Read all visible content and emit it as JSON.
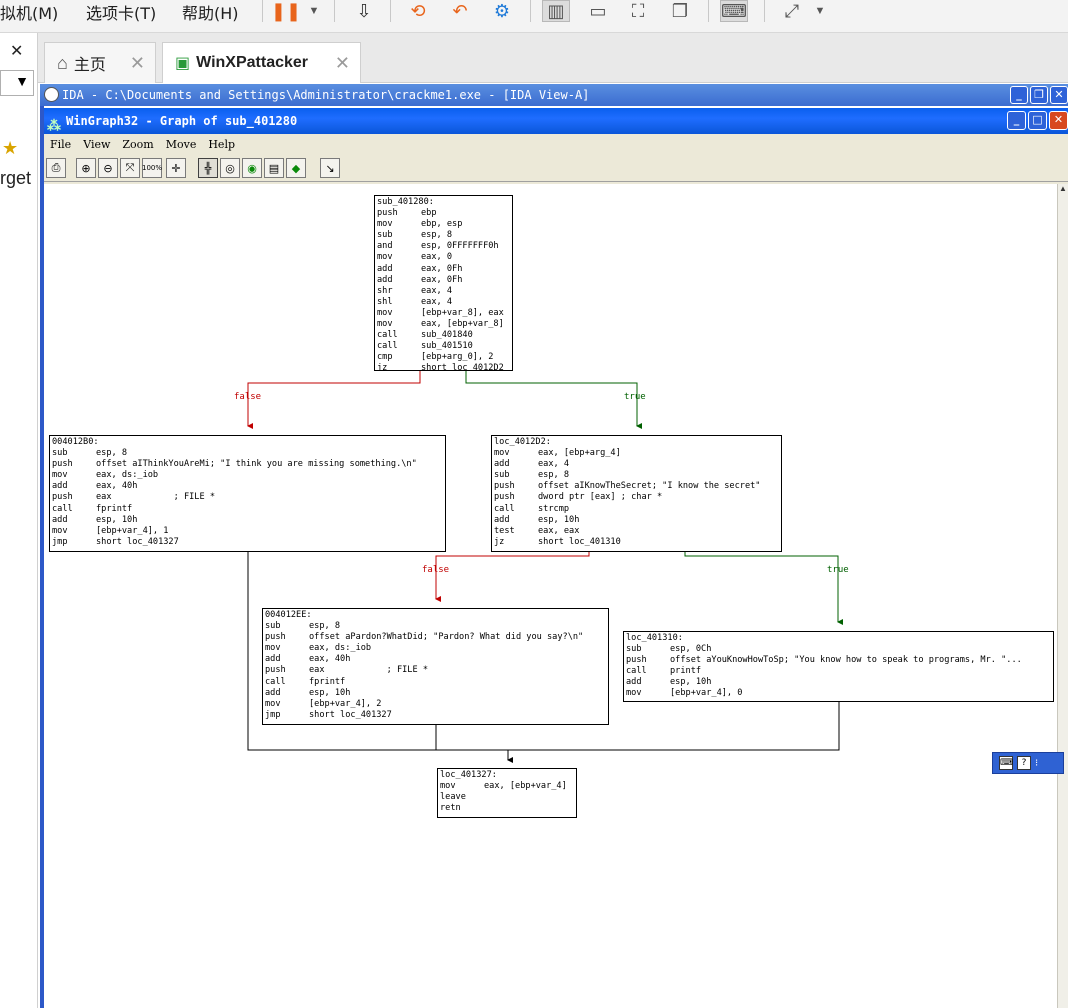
{
  "vm_menu": {
    "machine": "拟机(M)",
    "tabs_menu": "选项卡(T)",
    "help": "帮助(H)"
  },
  "left_panel": {
    "close_glyph": "✕",
    "partial_label": "rget"
  },
  "tabs": [
    {
      "label": "主页",
      "icon": "home-icon"
    },
    {
      "label": "WinXPattacker",
      "icon": "vm-play-icon"
    }
  ],
  "ida_window": {
    "title": "IDA - C:\\Documents and Settings\\Administrator\\crackme1.exe - [IDA View-A]"
  },
  "wingraph": {
    "title": "WinGraph32 - Graph of sub_401280",
    "menu": [
      "File",
      "View",
      "Zoom",
      "Move",
      "Help"
    ],
    "toolbar": [
      "print-icon",
      "zoom-in-icon",
      "zoom-out-icon",
      "fit-icon",
      "zoom-100-icon",
      "center-icon",
      "layout-icon",
      "circle-icon",
      "green-circle-icon",
      "image-icon",
      "green-node-icon",
      "arrow-cursor-icon"
    ],
    "toolbar_labels": {
      "zoom100": "100%"
    }
  },
  "graph": {
    "edge_labels": {
      "false": "false",
      "true": "true"
    },
    "nodes": [
      {
        "id": "sub_401280",
        "lines": [
          [
            "sub_401280:",
            ""
          ],
          [
            "push",
            "ebp"
          ],
          [
            "mov",
            "ebp, esp"
          ],
          [
            "sub",
            "esp, 8"
          ],
          [
            "and",
            "esp, 0FFFFFFF0h"
          ],
          [
            "mov",
            "eax, 0"
          ],
          [
            "add",
            "eax, 0Fh"
          ],
          [
            "add",
            "eax, 0Fh"
          ],
          [
            "shr",
            "eax, 4"
          ],
          [
            "shl",
            "eax, 4"
          ],
          [
            "mov",
            "[ebp+var_8], eax"
          ],
          [
            "mov",
            "eax, [ebp+var_8]"
          ],
          [
            "call",
            "sub_401840"
          ],
          [
            "call",
            "sub_401510"
          ],
          [
            "cmp",
            "[ebp+arg_0], 2"
          ],
          [
            "jz",
            "short loc_4012D2"
          ]
        ]
      },
      {
        "id": "004012B0",
        "lines": [
          [
            "004012B0:",
            ""
          ],
          [
            "sub",
            "esp, 8"
          ],
          [
            "push",
            "offset aIThinkYouAreMi; \"I think you are missing something.\\n\""
          ],
          [
            "mov",
            "eax, ds:_iob"
          ],
          [
            "add",
            "eax, 40h"
          ],
          [
            "push",
            "eax            ; FILE *"
          ],
          [
            "call",
            "fprintf"
          ],
          [
            "add",
            "esp, 10h"
          ],
          [
            "mov",
            "[ebp+var_4], 1"
          ],
          [
            "jmp",
            "short loc_401327"
          ]
        ]
      },
      {
        "id": "loc_4012D2",
        "lines": [
          [
            "loc_4012D2:",
            ""
          ],
          [
            "mov",
            "eax, [ebp+arg_4]"
          ],
          [
            "add",
            "eax, 4"
          ],
          [
            "sub",
            "esp, 8"
          ],
          [
            "push",
            "offset aIKnowTheSecret; \"I know the secret\""
          ],
          [
            "push",
            "dword ptr [eax] ; char *"
          ],
          [
            "call",
            "strcmp"
          ],
          [
            "add",
            "esp, 10h"
          ],
          [
            "test",
            "eax, eax"
          ],
          [
            "jz",
            "short loc_401310"
          ]
        ]
      },
      {
        "id": "004012EE",
        "lines": [
          [
            "004012EE:",
            ""
          ],
          [
            "sub",
            "esp, 8"
          ],
          [
            "push",
            "offset aPardon?WhatDid; \"Pardon? What did you say?\\n\""
          ],
          [
            "mov",
            "eax, ds:_iob"
          ],
          [
            "add",
            "eax, 40h"
          ],
          [
            "push",
            "eax            ; FILE *"
          ],
          [
            "call",
            "fprintf"
          ],
          [
            "add",
            "esp, 10h"
          ],
          [
            "mov",
            "[ebp+var_4], 2"
          ],
          [
            "jmp",
            "short loc_401327"
          ]
        ]
      },
      {
        "id": "loc_401310",
        "lines": [
          [
            "loc_401310:",
            ""
          ],
          [
            "sub",
            "esp, 0Ch"
          ],
          [
            "push",
            "offset aYouKnowHowToSp; \"You know how to speak to programs, Mr. \"..."
          ],
          [
            "call",
            "printf"
          ],
          [
            "add",
            "esp, 10h"
          ],
          [
            "mov",
            "[ebp+var_4], 0"
          ]
        ]
      },
      {
        "id": "loc_401327",
        "lines": [
          [
            "loc_401327:",
            ""
          ],
          [
            "mov",
            "eax, [ebp+var_4]"
          ],
          [
            "leave",
            ""
          ],
          [
            "retn",
            ""
          ]
        ]
      }
    ]
  },
  "colors": {
    "false_edge": "#c00000",
    "true_edge": "#006000",
    "title_bar": "#0a5fee"
  }
}
